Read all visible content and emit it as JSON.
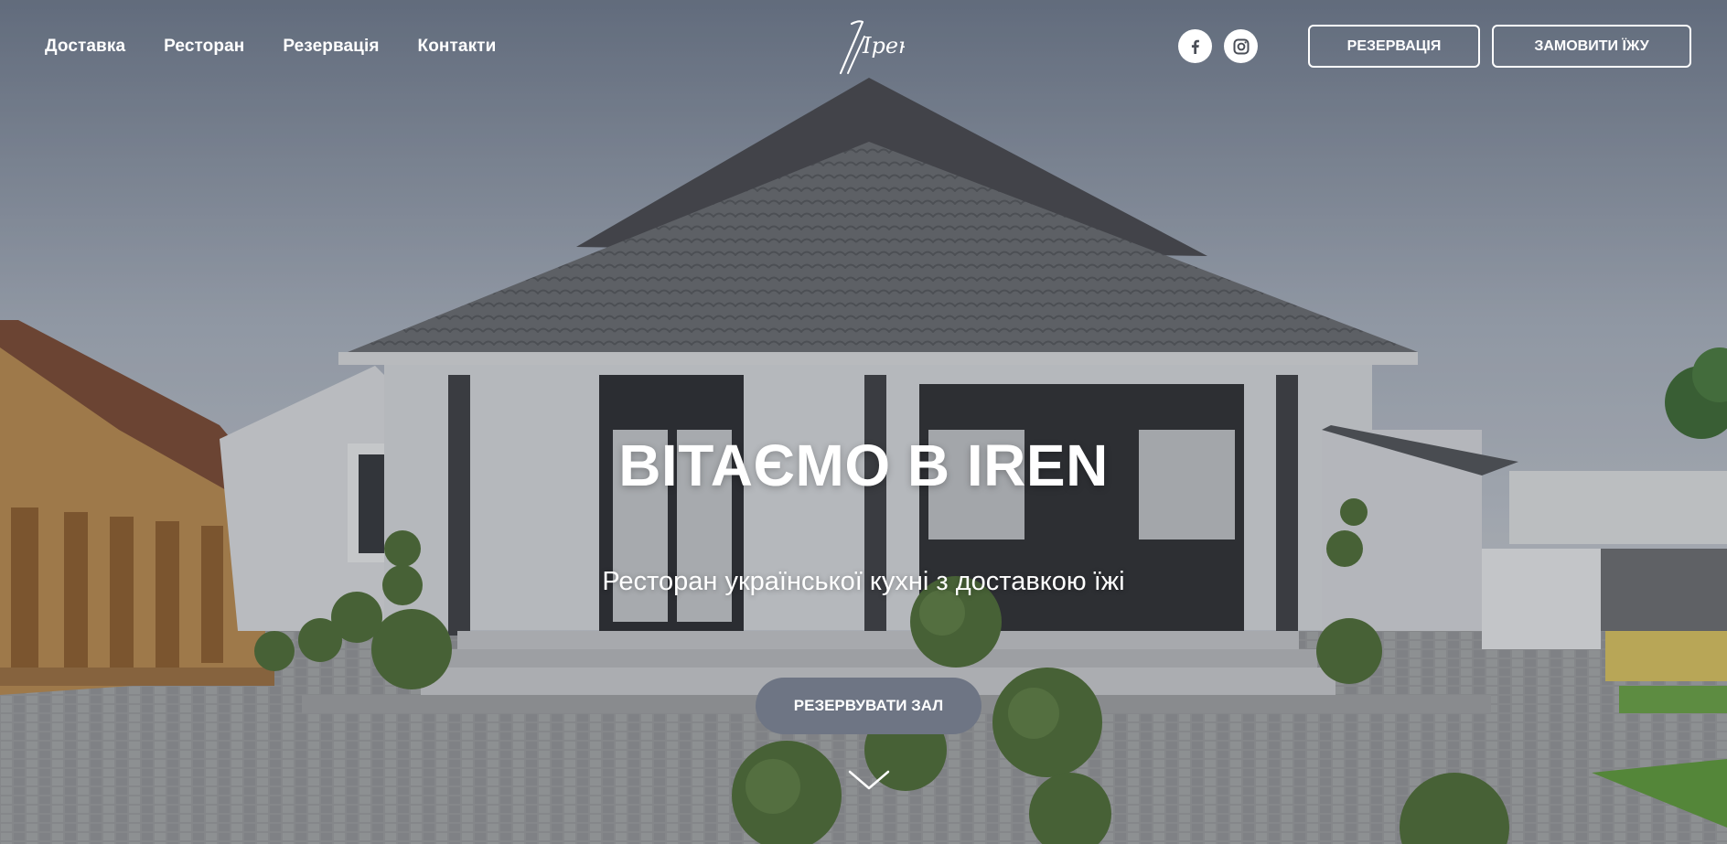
{
  "nav": {
    "items": [
      {
        "label": "Доставка"
      },
      {
        "label": "Ресторан"
      },
      {
        "label": "Резервація"
      },
      {
        "label": "Контакти"
      }
    ]
  },
  "logo": {
    "text": "Ірен"
  },
  "social": {
    "facebook_icon": "facebook-icon",
    "instagram_icon": "instagram-icon"
  },
  "header_buttons": {
    "reserve_label": "РЕЗЕРВАЦІЯ",
    "order_label": "ЗАМОВИТИ ЇЖУ"
  },
  "hero": {
    "title": "ВІТАЄМО В IREN",
    "subtitle": "Ресторан української кухні з доставкою їжі",
    "cta_label": "РЕЗЕРВУВАТИ ЗАЛ",
    "scroll_icon": "chevron-down-icon"
  },
  "colors": {
    "cta_background": "#6e7584",
    "text": "#ffffff"
  }
}
